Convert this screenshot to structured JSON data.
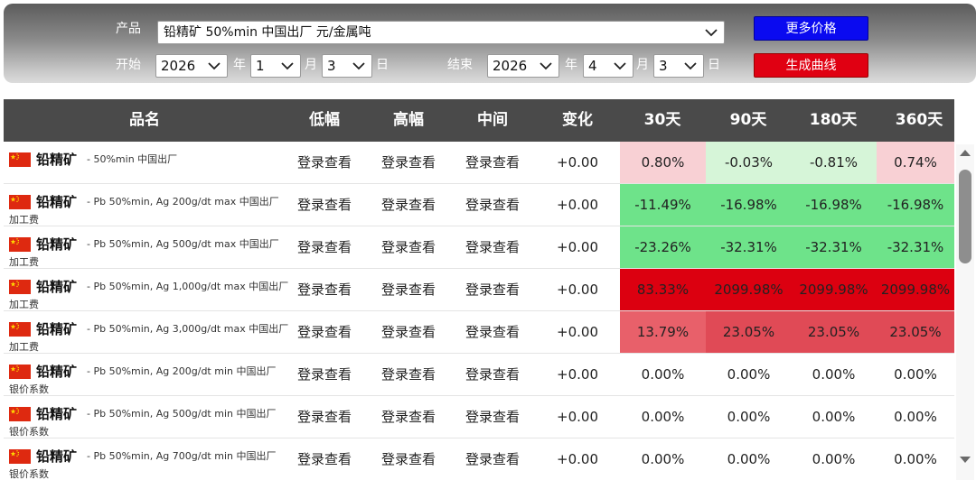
{
  "filters": {
    "product_label": "产品",
    "product_value": "铅精矿 50%min 中国出厂 元/金属吨",
    "start_label": "开始",
    "end_label": "结束",
    "start": {
      "year": "2026",
      "month": "1",
      "day": "3"
    },
    "end": {
      "year": "2026",
      "month": "4",
      "day": "3"
    },
    "year_unit": "年",
    "month_unit": "月",
    "day_unit": "日",
    "more_prices_button": "更多价格",
    "generate_curve_button": "生成曲线"
  },
  "table": {
    "headers": [
      "品名",
      "低幅",
      "高幅",
      "中间",
      "变化",
      "30天",
      "90天",
      "180天",
      "360天"
    ],
    "rows": [
      {
        "name": "铅精矿",
        "desc": "50%min 中国出厂",
        "sub": "",
        "low": "登录查看",
        "high": "登录查看",
        "mid": "登录查看",
        "change": "+0.00",
        "d30": "0.80%",
        "d90": "-0.03%",
        "d180": "-0.81%",
        "d360": "0.74%"
      },
      {
        "name": "铅精矿",
        "desc": "Pb 50%min, Ag 200g/dt max 中国出厂",
        "sub": "加工费",
        "low": "登录查看",
        "high": "登录查看",
        "mid": "登录查看",
        "change": "+0.00",
        "d30": "-11.49%",
        "d90": "-16.98%",
        "d180": "-16.98%",
        "d360": "-16.98%"
      },
      {
        "name": "铅精矿",
        "desc": "Pb 50%min, Ag 500g/dt max 中国出厂",
        "sub": "加工费",
        "low": "登录查看",
        "high": "登录查看",
        "mid": "登录查看",
        "change": "+0.00",
        "d30": "-23.26%",
        "d90": "-32.31%",
        "d180": "-32.31%",
        "d360": "-32.31%"
      },
      {
        "name": "铅精矿",
        "desc": "Pb 50%min, Ag 1,000g/dt max 中国出厂",
        "sub": "加工费",
        "low": "登录查看",
        "high": "登录查看",
        "mid": "登录查看",
        "change": "+0.00",
        "d30": "83.33%",
        "d90": "2099.98%",
        "d180": "2099.98%",
        "d360": "2099.98%"
      },
      {
        "name": "铅精矿",
        "desc": "Pb 50%min, Ag 3,000g/dt max 中国出厂",
        "sub": "加工费",
        "low": "登录查看",
        "high": "登录查看",
        "mid": "登录查看",
        "change": "+0.00",
        "d30": "13.79%",
        "d90": "23.05%",
        "d180": "23.05%",
        "d360": "23.05%"
      },
      {
        "name": "铅精矿",
        "desc": "Pb 50%min, Ag 200g/dt min 中国出厂",
        "sub": "银价系数",
        "low": "登录查看",
        "high": "登录查看",
        "mid": "登录查看",
        "change": "+0.00",
        "d30": "0.00%",
        "d90": "0.00%",
        "d180": "0.00%",
        "d360": "0.00%"
      },
      {
        "name": "铅精矿",
        "desc": "Pb 50%min, Ag 500g/dt min 中国出厂",
        "sub": "银价系数",
        "low": "登录查看",
        "high": "登录查看",
        "mid": "登录查看",
        "change": "+0.00",
        "d30": "0.00%",
        "d90": "0.00%",
        "d180": "0.00%",
        "d360": "0.00%"
      },
      {
        "name": "铅精矿",
        "desc": "Pb 50%min, Ag 700g/dt min 中国出厂",
        "sub": "银价系数",
        "low": "登录查看",
        "high": "登录查看",
        "mid": "登录查看",
        "change": "+0.00",
        "d30": "0.00%",
        "d90": "0.00%",
        "d180": "0.00%",
        "d360": "0.00%"
      }
    ],
    "cell_colors": [
      [
        "#f8d0d4",
        "#d6f5d8",
        "#d6f5d8",
        "#f8d0d4"
      ],
      [
        "#6ee38a",
        "#6ee38a",
        "#6ee38a",
        "#6ee38a"
      ],
      [
        "#6ee38a",
        "#6ee38a",
        "#6ee38a",
        "#6ee38a"
      ],
      [
        "#dc0010",
        "#dc0010",
        "#dc0010",
        "#dc0010"
      ],
      [
        "#e8606a",
        "#e04a56",
        "#e04a56",
        "#e04a56"
      ],
      [
        "#ffffff",
        "#ffffff",
        "#ffffff",
        "#ffffff"
      ],
      [
        "#ffffff",
        "#ffffff",
        "#ffffff",
        "#ffffff"
      ],
      [
        "#ffffff",
        "#ffffff",
        "#ffffff",
        "#ffffff"
      ]
    ],
    "flag_icon": "china-flag-icon"
  }
}
